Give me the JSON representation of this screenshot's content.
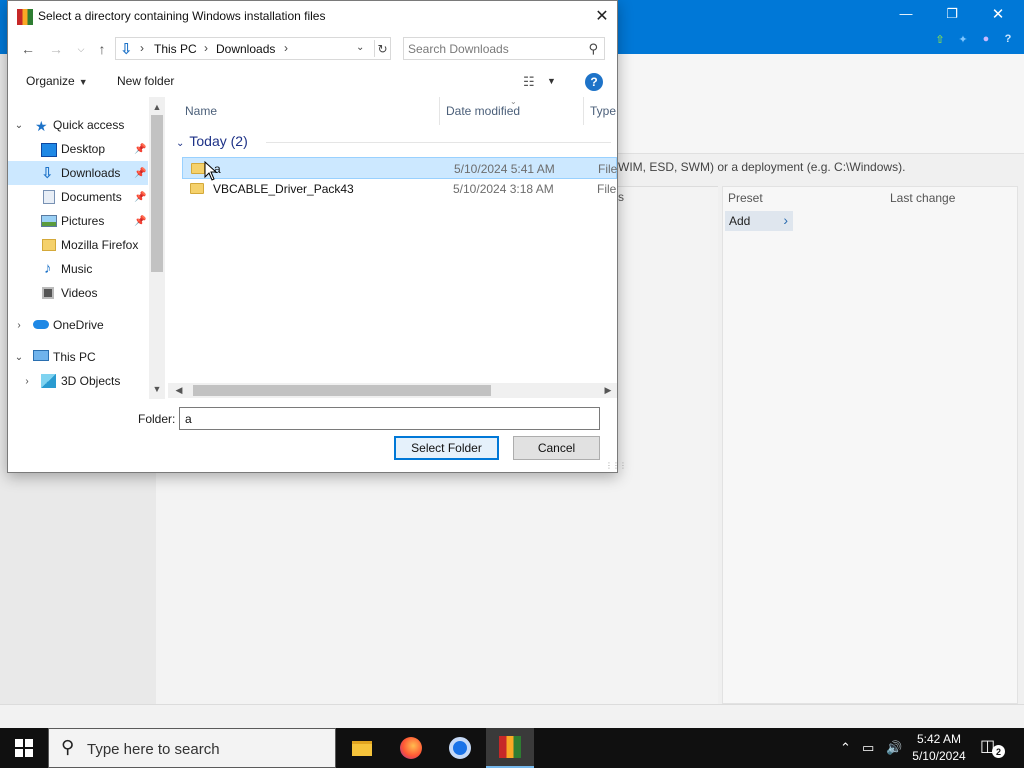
{
  "app": {
    "hint_text": "WIM, ESD, SWM) or a deployment (e.g. C:\\Windows).",
    "panel1_header": "s",
    "panel2": {
      "col_preset": "Preset",
      "col_last_change": "Last change",
      "add_label": "Add"
    }
  },
  "dialog": {
    "title": "Select a directory containing Windows installation files",
    "address": {
      "segments": [
        "This PC",
        "Downloads"
      ]
    },
    "search_placeholder": "Search Downloads",
    "commands": {
      "organize": "Organize",
      "new_folder": "New folder"
    },
    "nav_pane": {
      "items": [
        {
          "label": "Quick access",
          "icon": "star-icon"
        },
        {
          "label": "Desktop",
          "icon": "desktop-icon"
        },
        {
          "label": "Downloads",
          "icon": "download-icon"
        },
        {
          "label": "Documents",
          "icon": "documents-icon"
        },
        {
          "label": "Pictures",
          "icon": "pictures-icon"
        },
        {
          "label": "Mozilla Firefox",
          "icon": "folder-icon"
        },
        {
          "label": "Music",
          "icon": "music-icon"
        },
        {
          "label": "Videos",
          "icon": "videos-icon"
        },
        {
          "label": "OneDrive",
          "icon": "cloud-icon"
        },
        {
          "label": "This PC",
          "icon": "computer-icon"
        },
        {
          "label": "3D Objects",
          "icon": "cube-icon"
        }
      ]
    },
    "columns": {
      "name": "Name",
      "date_modified": "Date modified",
      "type": "Type"
    },
    "group": {
      "label": "Today (2)"
    },
    "files": [
      {
        "name": "a",
        "date": "5/10/2024 5:41 AM",
        "type": "File f"
      },
      {
        "name": "VBCABLE_Driver_Pack43",
        "date": "5/10/2024 3:18 AM",
        "type": "File f"
      }
    ],
    "folder_label": "Folder:",
    "folder_value": "a",
    "select_button": "Select Folder",
    "cancel_button": "Cancel"
  },
  "taskbar": {
    "search_placeholder": "Type here to search",
    "time": "5:42 AM",
    "date": "5/10/2024",
    "notification_count": "2"
  },
  "colors": {
    "accent": "#0078d7",
    "selection": "#cce8ff",
    "taskbar": "#101010"
  }
}
